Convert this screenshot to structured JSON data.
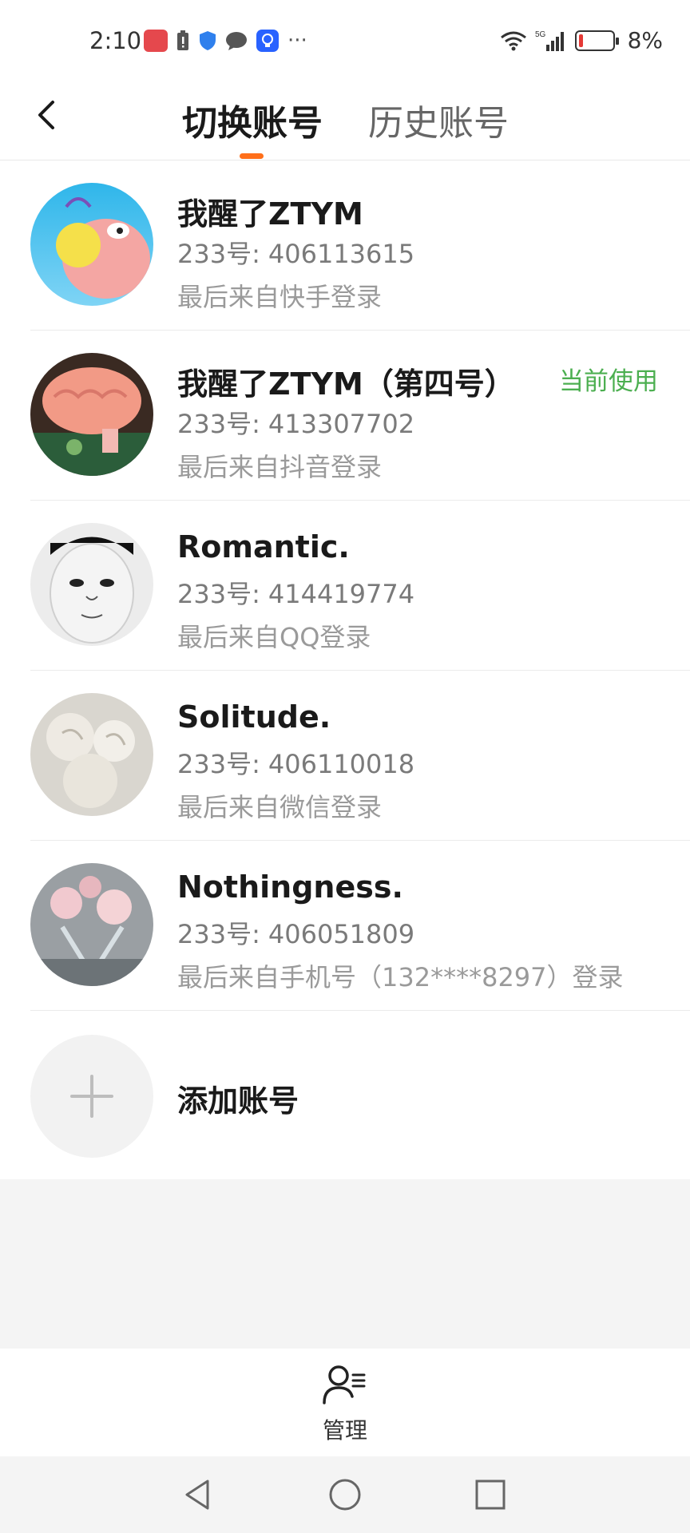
{
  "status_bar": {
    "time": "2:10",
    "battery_percent": "8%",
    "network": "5G"
  },
  "header": {
    "tab_active": "切换账号",
    "tab_inactive": "历史账号"
  },
  "accounts": [
    {
      "name": "我醒了ZTYM",
      "uid_label": "233号:",
      "uid": "406113615",
      "last_login": "最后来自快手登录",
      "badge": ""
    },
    {
      "name": "我醒了ZTYM（第四号）",
      "uid_label": "233号:",
      "uid": "413307702",
      "last_login": "最后来自抖音登录",
      "badge": "当前使用"
    },
    {
      "name": "Romantic.",
      "uid_label": "233号:",
      "uid": "414419774",
      "last_login": "最后来自QQ登录",
      "badge": ""
    },
    {
      "name": "Solitude.",
      "uid_label": "233号:",
      "uid": "406110018",
      "last_login": "最后来自微信登录",
      "badge": ""
    },
    {
      "name": "Nothingness.",
      "uid_label": "233号:",
      "uid": "406051809",
      "last_login": "最后来自手机号（132****8297）登录",
      "badge": ""
    }
  ],
  "add_account": {
    "label": "添加账号",
    "icon": "plus-icon"
  },
  "manage": {
    "label": "管理",
    "icon": "user-manage-icon"
  },
  "colors": {
    "accent": "#ff6f1a",
    "current_badge": "#4caf50",
    "background_gray": "#f4f4f4"
  }
}
